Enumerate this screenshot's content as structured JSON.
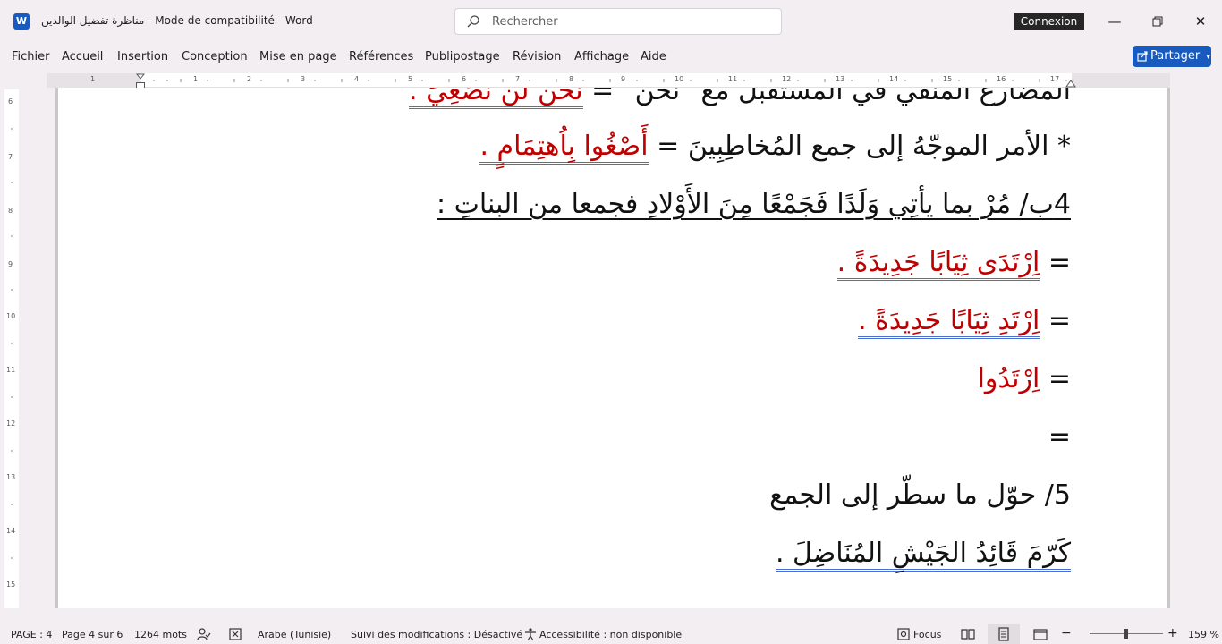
{
  "titlebar": {
    "doc_title": "مناظرة تفضيل الوالدين  -  Mode de compatibilité  -  Word",
    "search_placeholder": "Rechercher",
    "connexion": "Connexion",
    "app_icon_letter": "W"
  },
  "menu": {
    "items": [
      "Fichier",
      "Accueil",
      "Insertion",
      "Conception",
      "Mise en page",
      "Références",
      "Publipostage",
      "Révision",
      "Affichage",
      "Aide"
    ],
    "share_label": "Partager"
  },
  "ruler": {
    "h_labels": [
      "1",
      "2",
      "1",
      "2",
      "3",
      "4",
      "5",
      "6",
      "7",
      "8",
      "9",
      "10",
      "11",
      "12",
      "13",
      "14",
      "15",
      "16",
      "17"
    ],
    "v_labels": [
      "6",
      "7",
      "8",
      "9",
      "10",
      "11",
      "12",
      "13",
      "14",
      "15"
    ]
  },
  "document": {
    "line0": "المضارع المنفي في المستقبل مع \"نحن\" =",
    "line0_red": "نحن لن نُصْغِيَ .",
    "line1_prefix": "* الأمر الموجّهُ إلى جمع المُخاطِبِينَ  =",
    "line1_red": "أَصْغُوا بِاُهتِمَامٍ .",
    "line2": "4ب/ مُرْ بما يأتِي وَلَدًا فَجَمْعًا مِنَ الأَوْلادِ فجمعا من البناتِ :",
    "line3_eq": "=",
    "line3_red": "اِرْتَدَى ثِيَابًا جَدِيدَةً .",
    "line4_eq": "=",
    "line4_red": "اِرْتَدِ ثِيَابًا جَدِيدَةً .",
    "line5_eq": "=",
    "line5_red": "اِرْتَدُوا",
    "line6_eq": "=",
    "line7": "5/ حوّل ما سطّر إلى الجمع",
    "line8": "كَرّمَ قَائِدُ الجَيْشِ المُنَاضِلَ ."
  },
  "status": {
    "page": "PAGE : 4",
    "page_of": "Page 4 sur 6",
    "words": "1264 mots",
    "language": "Arabe (Tunisie)",
    "tracking": "Suivi des modifications : Désactivé",
    "accessibility": "Accessibilité : non disponible",
    "focus": "Focus",
    "zoom": "159 %"
  }
}
